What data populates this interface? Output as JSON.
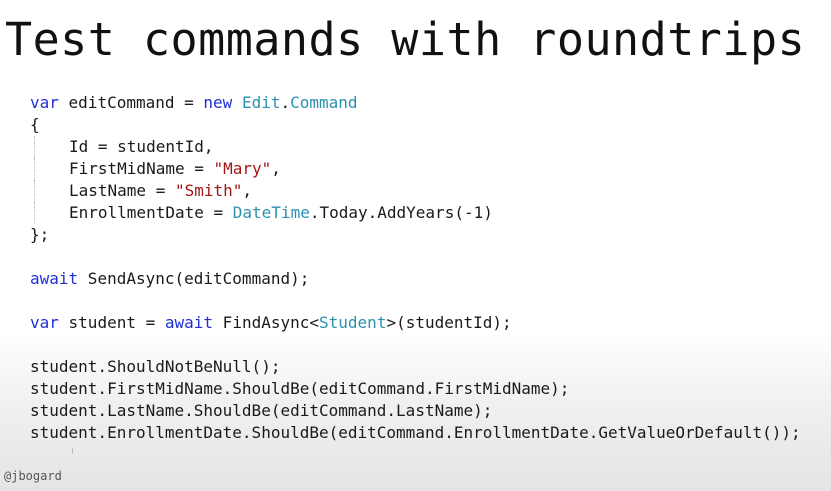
{
  "slide": {
    "title": "Test commands with roundtrips",
    "author": "@jbogard"
  },
  "code": {
    "line1": {
      "kw1": "var",
      "t1": " editCommand = ",
      "kw2": "new",
      "t2": " ",
      "ty1": "Edit",
      "t3": ".",
      "ty2": "Command"
    },
    "line2": "{",
    "line3": "Id = studentId,",
    "line4": {
      "t1": "FirstMidName = ",
      "s1": "\"Mary\"",
      "t2": ","
    },
    "line5": {
      "t1": "LastName = ",
      "s1": "\"Smith\"",
      "t2": ","
    },
    "line6": {
      "t1": "EnrollmentDate = ",
      "ty1": "DateTime",
      "t2": ".Today.AddYears(-1)"
    },
    "line7": "};",
    "line8": {
      "kw1": "await",
      "t1": " SendAsync(editCommand);"
    },
    "line9": {
      "kw1": "var",
      "t1": " student = ",
      "kw2": "await",
      "t2": " FindAsync<",
      "ty1": "Student",
      "t3": ">(studentId);"
    },
    "line10": "student.ShouldNotBeNull();",
    "line11": "student.FirstMidName.ShouldBe(editCommand.FirstMidName);",
    "line12": "student.LastName.ShouldBe(editCommand.LastName);",
    "line13": "student.EnrollmentDate.ShouldBe(editCommand.EnrollmentDate.GetValueOrDefault());"
  }
}
